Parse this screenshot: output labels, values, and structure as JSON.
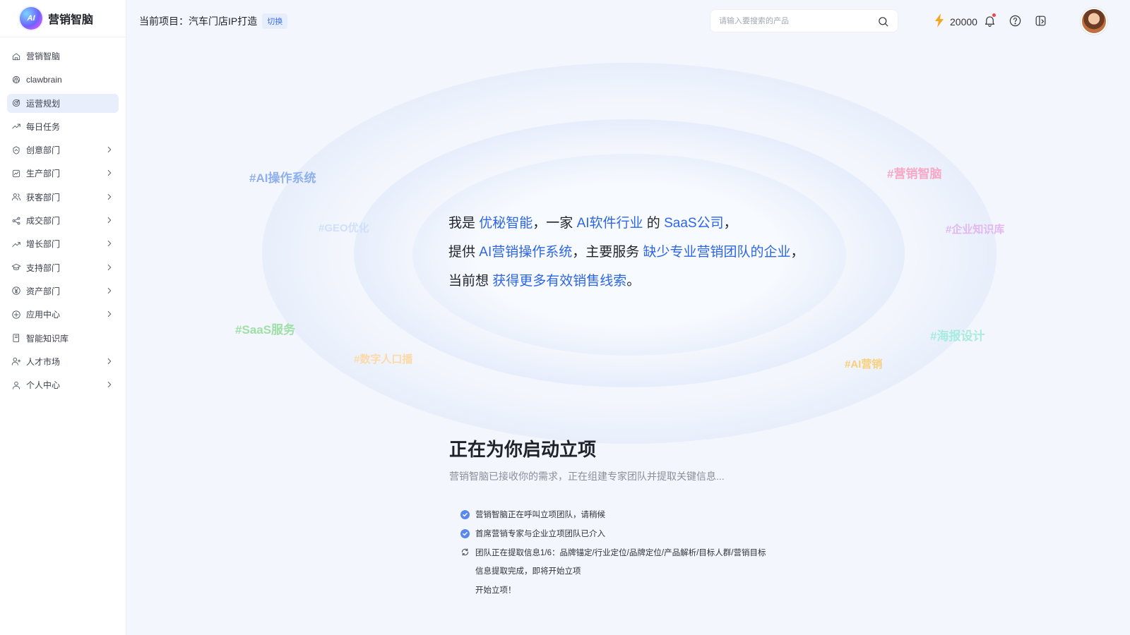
{
  "brand": {
    "name": "营销智脑",
    "logo_text": "AI"
  },
  "sidebar": {
    "items": [
      {
        "label": "营销智脑",
        "icon": "home-icon",
        "chevron": false,
        "active": false
      },
      {
        "label": "clawbrain",
        "icon": "brain-icon",
        "chevron": false,
        "active": false
      },
      {
        "label": "运营规划",
        "icon": "target-icon",
        "chevron": false,
        "active": true
      },
      {
        "label": "每日任务",
        "icon": "trend-up-icon",
        "chevron": false,
        "active": false
      },
      {
        "label": "创意部门",
        "icon": "shield-icon",
        "chevron": true,
        "active": false
      },
      {
        "label": "生产部门",
        "icon": "chart-icon",
        "chevron": true,
        "active": false
      },
      {
        "label": "获客部门",
        "icon": "users-icon",
        "chevron": true,
        "active": false
      },
      {
        "label": "成交部门",
        "icon": "share-icon",
        "chevron": true,
        "active": false
      },
      {
        "label": "增长部门",
        "icon": "growth-icon",
        "chevron": true,
        "active": false
      },
      {
        "label": "支持部门",
        "icon": "graduation-cap-icon",
        "chevron": true,
        "active": false
      },
      {
        "label": "资产部门",
        "icon": "yen-icon",
        "chevron": true,
        "active": false
      },
      {
        "label": "应用中心",
        "icon": "apps-icon",
        "chevron": true,
        "active": false
      },
      {
        "label": "智能知识库",
        "icon": "book-icon",
        "chevron": false,
        "active": false
      },
      {
        "label": "人才市场",
        "icon": "user-plus-icon",
        "chevron": true,
        "active": false
      },
      {
        "label": "个人中心",
        "icon": "user-icon",
        "chevron": true,
        "active": false
      }
    ]
  },
  "header": {
    "project_label": "当前项目：汽车门店IP打造",
    "switch_label": "切换",
    "search_placeholder": "请输入要搜索的产品",
    "credits": "20000"
  },
  "tags": [
    {
      "text": "#AI操作系统",
      "color": "#8fb0ee"
    },
    {
      "text": "#GEO优化",
      "color": "#cfe0fb"
    },
    {
      "text": "#SaaS服务",
      "color": "#9fe0a8"
    },
    {
      "text": "#数字人口播",
      "color": "#fcd9a8"
    },
    {
      "text": "#营销智脑",
      "color": "#f6a8c4"
    },
    {
      "text": "#企业知识库",
      "color": "#e2b8ef"
    },
    {
      "text": "#海报设计",
      "color": "#a8ecdf"
    },
    {
      "text": "#AI营销",
      "color": "#f8cf7a"
    }
  ],
  "intro": {
    "line1": {
      "a": "我是 ",
      "b": "优秘智能",
      "c": "，一家 ",
      "d": "AI软件行业",
      "e": " 的 ",
      "f": "SaaS公司",
      "g": "，"
    },
    "line2": {
      "a": "提供 ",
      "b": "AI营销操作系统",
      "c": "，主要服务 ",
      "d": "缺少专业营销团队的企业",
      "e": "，"
    },
    "line3": {
      "a": "当前想 ",
      "b": "获得更多有效销售线索",
      "c": "。"
    }
  },
  "launch": {
    "title": "正在为你启动立项",
    "subtitle": "营销智脑已接收你的需求，正在组建专家团队并提取关键信息..."
  },
  "steps": [
    {
      "text": "营销智脑正在呼叫立项团队，请稍候",
      "status": "done"
    },
    {
      "text": "首席营销专家与企业立项团队已介入",
      "status": "done"
    },
    {
      "text": "团队正在提取信息1/6：品牌锚定/行业定位/品牌定位/产品解析/目标人群/营销目标",
      "status": "loading"
    },
    {
      "text": "信息提取完成，即将开始立项",
      "status": "pending"
    },
    {
      "text": "开始立项！",
      "status": "pending"
    }
  ]
}
